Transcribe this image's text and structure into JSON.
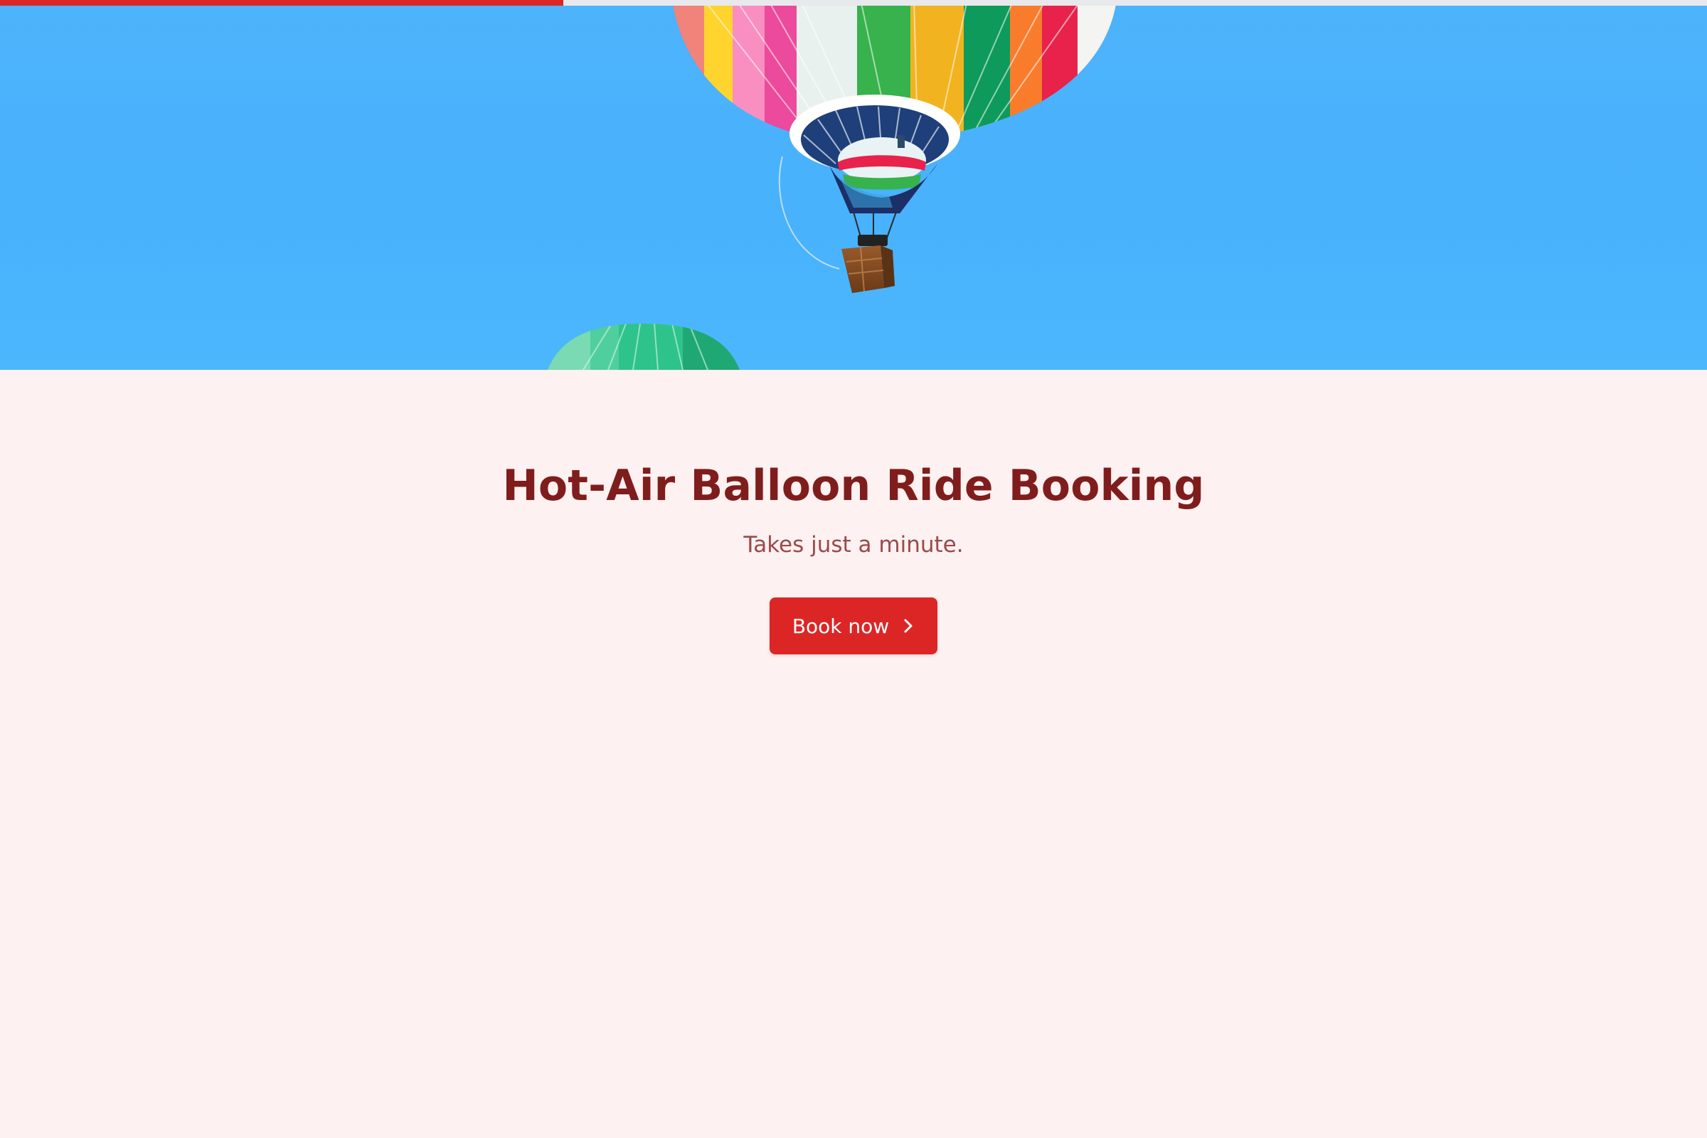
{
  "progress": {
    "fraction": 0.33,
    "color": "#dc2626"
  },
  "hero": {
    "image_subject": "hot-air balloons in a clear blue sky"
  },
  "main": {
    "title": "Hot-Air Balloon Ride Booking",
    "subtitle": "Takes just a minute.",
    "cta_label": "Book now",
    "cta_icon": "chevron-right-icon"
  },
  "colors": {
    "background": "#fdf1f1",
    "title": "#7f1d1d",
    "subtitle": "#9a4a4a",
    "accent": "#dc2626",
    "sky": "#4ab4fc"
  }
}
